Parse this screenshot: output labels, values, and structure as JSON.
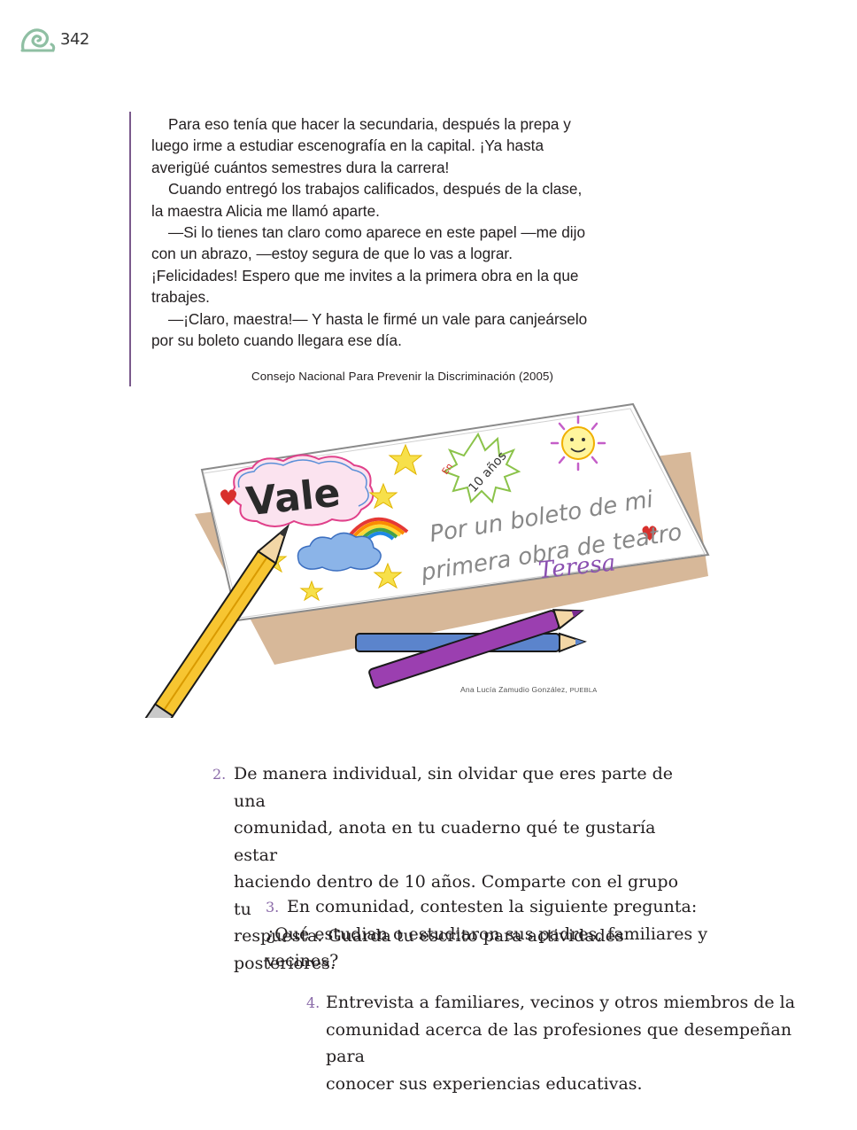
{
  "header": {
    "page_number": "342",
    "icon": "snail-spiral-icon",
    "icon_color": "#8fbfa3"
  },
  "story": {
    "paragraphs": [
      "Para eso tenía que hacer la secundaria, después la prepa y luego irme a estudiar escenografía en la capital. ¡Ya hasta averigüé cuántos semestres dura la carrera!",
      "Cuando entregó los trabajos calificados, después de la clase, la maestra Alicia me llamó aparte.",
      "—Si lo tienes tan claro como aparece en este papel —me dijo con un abrazo, —estoy segura de que lo vas a lograr. ¡Felicidades! Espero que me invites a la primera obra en la que trabajes.",
      "—¡Claro, maestra!— Y hasta le firmé un vale para canjeárselo por su boleto cuando llegara ese día."
    ],
    "source": "Consejo Nacional Para Prevenir la Discriminación (2005)",
    "rule_color": "#7a5a8c"
  },
  "illustration": {
    "voucher_title": "Vale",
    "badge_line1": "En",
    "badge_line2": "10 años",
    "line1": "Por un boleto de mi",
    "line2": "primera obra de teatro",
    "signature": "Teresa",
    "credit_name": "Ana Lucía Zamudio González,",
    "credit_place": "PUEBLA"
  },
  "activities": [
    {
      "number": "2.",
      "lines": [
        "De manera individual, sin olvidar que eres parte de una",
        "comunidad, anota en tu cuaderno qué te gustaría estar",
        "haciendo dentro de 10 años. Comparte con el grupo tu",
        "respuesta. Guarda tu escrito para actividades posteriores."
      ]
    },
    {
      "number": "3.",
      "lines": [
        "En comunidad, contesten la siguiente pregunta:",
        "¿Qué estudian o estudiaron sus padres, familiares y vecinos?"
      ]
    },
    {
      "number": "4.",
      "lines": [
        "Entrevista a familiares, vecinos y otros miembros de la",
        "comunidad acerca de las profesiones que desempeñan para",
        "conocer sus experiencias educativas."
      ]
    }
  ],
  "colors": {
    "accent_purple": "#8a6aa8",
    "text": "#231f20"
  }
}
